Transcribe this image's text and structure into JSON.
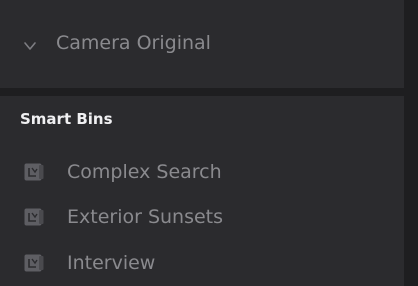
{
  "folder": {
    "label": "Camera Original",
    "expand_icon": "chevron-down-icon"
  },
  "smart_bins": {
    "title": "Smart Bins",
    "items": [
      {
        "label": "Complex Search",
        "icon": "smart-bin-icon"
      },
      {
        "label": "Exterior Sunsets",
        "icon": "smart-bin-icon"
      },
      {
        "label": "Interview",
        "icon": "smart-bin-icon"
      }
    ]
  }
}
